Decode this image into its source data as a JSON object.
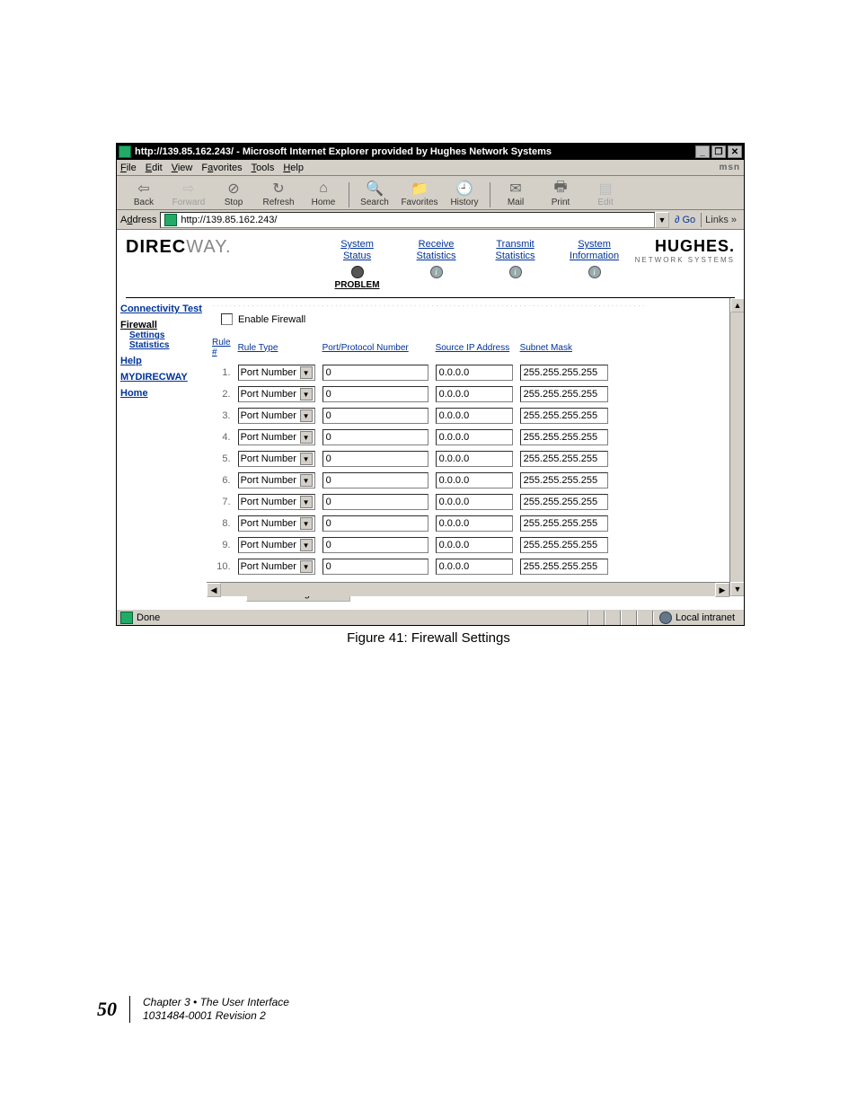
{
  "window": {
    "title": "http://139.85.162.243/ - Microsoft Internet Explorer provided by Hughes Network Systems",
    "min": "_",
    "max": "❐",
    "close": "✕"
  },
  "menu": {
    "file": "File",
    "edit": "Edit",
    "view": "View",
    "favorites": "Favorites",
    "tools": "Tools",
    "help": "Help",
    "msn": "msn"
  },
  "toolbar": {
    "back": "Back",
    "forward": "Forward",
    "stop": "Stop",
    "refresh": "Refresh",
    "home": "Home",
    "search": "Search",
    "favorites": "Favorites",
    "history": "History",
    "mail": "Mail",
    "print": "Print",
    "edit": "Edit"
  },
  "address": {
    "label": "Address",
    "url": "http://139.85.162.243/",
    "go": "Go",
    "links": "Links »"
  },
  "brand": {
    "direc": "DIREC",
    "way": "WAY.",
    "hughes": "HUGHES.",
    "hughes_sub": "NETWORK SYSTEMS"
  },
  "nav": {
    "system_status": {
      "l1": "System",
      "l2": "Status"
    },
    "receive_stats": {
      "l1": "Receive",
      "l2": "Statistics"
    },
    "transmit_stats": {
      "l1": "Transmit",
      "l2": "Statistics"
    },
    "system_info": {
      "l1": "System",
      "l2": "Information"
    },
    "problem": "PROBLEM"
  },
  "sidebar": {
    "connectivity": "Connectivity Test",
    "firewall": "Firewall",
    "settings": "Settings",
    "statistics": "Statistics",
    "help": "Help",
    "mydirecway": "MYDIRECWAY",
    "home": "Home"
  },
  "firewall": {
    "enable_label": "Enable Firewall",
    "headers": {
      "rule_num": "Rule #",
      "rule_type": "Rule Type",
      "port": "Port/Protocol Number",
      "source_ip": "Source IP Address",
      "subnet": "Subnet Mask"
    },
    "rows": [
      {
        "num": "1.",
        "type": "Port Number",
        "port": "0",
        "ip": "0.0.0.0",
        "mask": "255.255.255.255"
      },
      {
        "num": "2.",
        "type": "Port Number",
        "port": "0",
        "ip": "0.0.0.0",
        "mask": "255.255.255.255"
      },
      {
        "num": "3.",
        "type": "Port Number",
        "port": "0",
        "ip": "0.0.0.0",
        "mask": "255.255.255.255"
      },
      {
        "num": "4.",
        "type": "Port Number",
        "port": "0",
        "ip": "0.0.0.0",
        "mask": "255.255.255.255"
      },
      {
        "num": "5.",
        "type": "Port Number",
        "port": "0",
        "ip": "0.0.0.0",
        "mask": "255.255.255.255"
      },
      {
        "num": "6.",
        "type": "Port Number",
        "port": "0",
        "ip": "0.0.0.0",
        "mask": "255.255.255.255"
      },
      {
        "num": "7.",
        "type": "Port Number",
        "port": "0",
        "ip": "0.0.0.0",
        "mask": "255.255.255.255"
      },
      {
        "num": "8.",
        "type": "Port Number",
        "port": "0",
        "ip": "0.0.0.0",
        "mask": "255.255.255.255"
      },
      {
        "num": "9.",
        "type": "Port Number",
        "port": "0",
        "ip": "0.0.0.0",
        "mask": "255.255.255.255"
      },
      {
        "num": "10.",
        "type": "Port Number",
        "port": "0",
        "ip": "0.0.0.0",
        "mask": "255.255.255.255"
      }
    ],
    "save": "Save Configuration"
  },
  "status": {
    "done": "Done",
    "zone": "Local intranet"
  },
  "caption": "Figure 41:  Firewall Settings",
  "footer": {
    "page": "50",
    "chapter": "Chapter 3 • The User Interface",
    "doc": "1031484-0001  Revision 2"
  }
}
